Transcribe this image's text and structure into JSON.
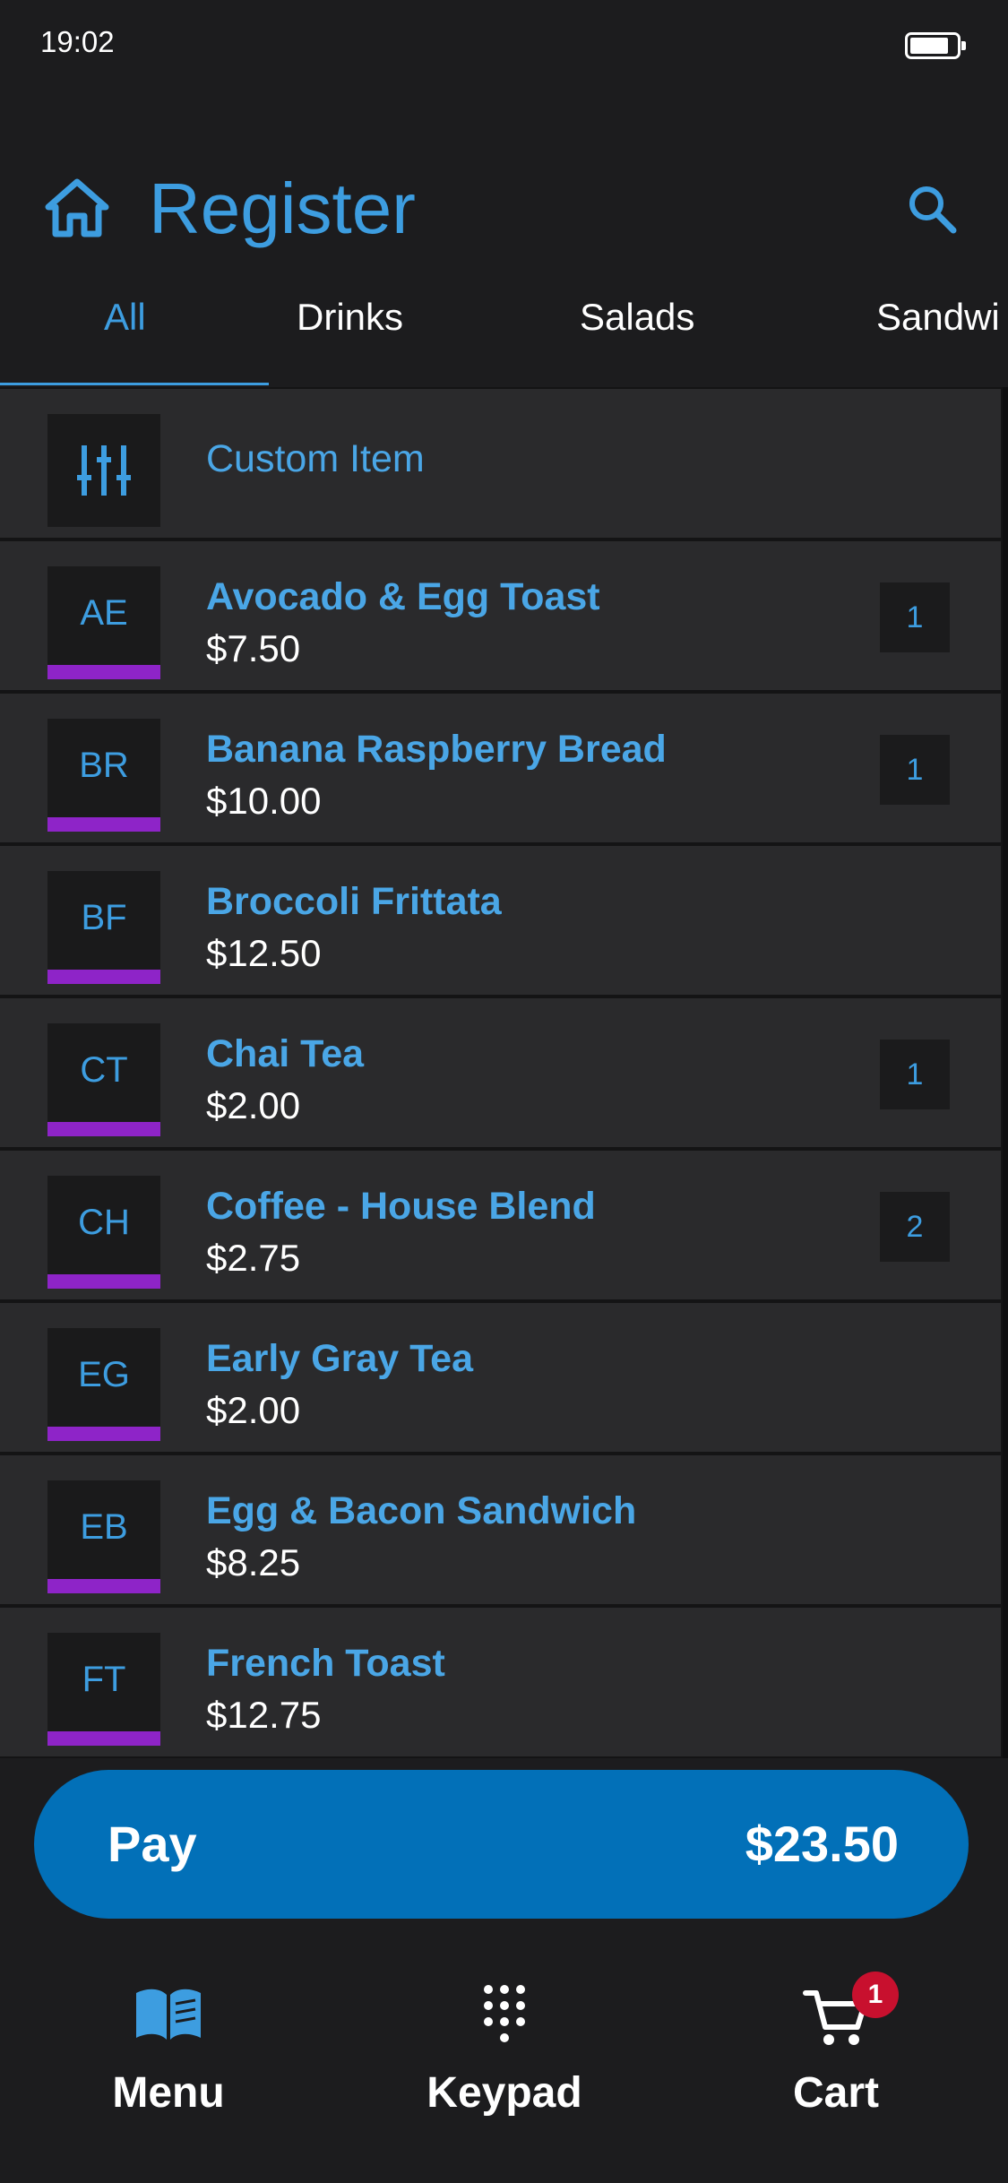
{
  "status_bar": {
    "time": "19:02"
  },
  "header": {
    "title": "Register",
    "home_icon": "home-icon",
    "search_icon": "search-icon"
  },
  "tabs": [
    {
      "label": "All",
      "active": true
    },
    {
      "label": "Drinks",
      "active": false
    },
    {
      "label": "Salads",
      "active": false
    },
    {
      "label": "Sandwi",
      "active": false
    }
  ],
  "custom_item": {
    "label": "Custom Item",
    "icon": "sliders-icon"
  },
  "items": [
    {
      "initials": "AE",
      "name": "Avocado & Egg Toast",
      "price": "$7.50",
      "qty": "1"
    },
    {
      "initials": "BR",
      "name": "Banana Raspberry Bread",
      "price": "$10.00",
      "qty": "1"
    },
    {
      "initials": "BF",
      "name": "Broccoli Frittata",
      "price": "$12.50",
      "qty": ""
    },
    {
      "initials": "CT",
      "name": "Chai Tea",
      "price": "$2.00",
      "qty": "1"
    },
    {
      "initials": "CH",
      "name": "Coffee - House Blend",
      "price": "$2.75",
      "qty": "2"
    },
    {
      "initials": "EG",
      "name": "Early Gray Tea",
      "price": "$2.00",
      "qty": ""
    },
    {
      "initials": "EB",
      "name": "Egg & Bacon Sandwich",
      "price": "$8.25",
      "qty": ""
    },
    {
      "initials": "FT",
      "name": "French Toast",
      "price": "$12.75",
      "qty": ""
    }
  ],
  "pay": {
    "label": "Pay",
    "total": "$23.50"
  },
  "bottom_nav": {
    "menu": {
      "label": "Menu",
      "icon": "book-icon"
    },
    "keypad": {
      "label": "Keypad",
      "icon": "keypad-icon"
    },
    "cart": {
      "label": "Cart",
      "icon": "cart-icon",
      "badge": "1"
    }
  },
  "colors": {
    "accent": "#3d9de0",
    "background": "#1c1c1e",
    "row": "#2a2a2c",
    "tile_bar": "#8e24c8",
    "pay_button": "#0270b8",
    "badge": "#c8102e"
  }
}
